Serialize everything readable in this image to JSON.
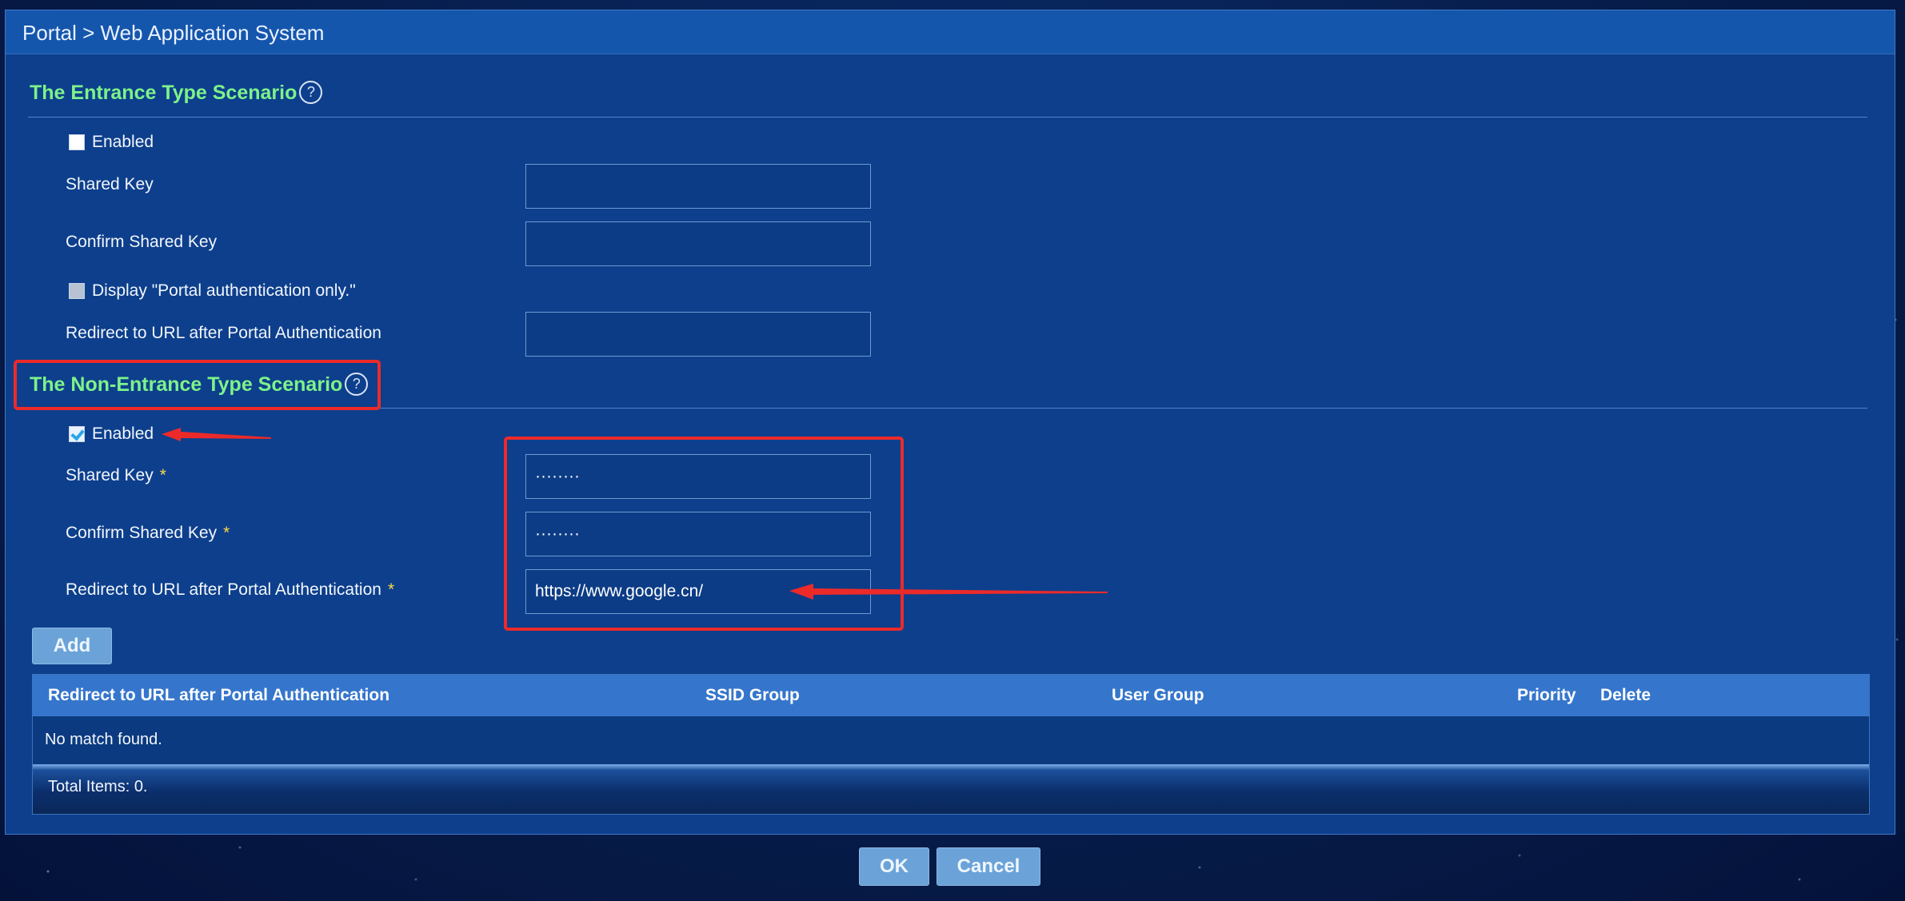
{
  "breadcrumb": "Portal > Web Application System",
  "entrance": {
    "title": "The Entrance Type Scenario",
    "help_icon": "?",
    "enabled_label": "Enabled",
    "shared_key_label": "Shared Key",
    "shared_key_value": "",
    "confirm_key_label": "Confirm Shared Key",
    "confirm_key_value": "",
    "display_only_label": "Display \"Portal authentication only.\"",
    "redirect_label": "Redirect to URL after Portal Authentication",
    "redirect_value": ""
  },
  "non_entrance": {
    "title": "The Non-Entrance Type Scenario",
    "help_icon": "?",
    "enabled_label": "Enabled",
    "enabled_checked": true,
    "shared_key_label": "Shared Key",
    "shared_key_value": "········",
    "confirm_key_label": "Confirm Shared Key",
    "confirm_key_value": "········",
    "redirect_label": "Redirect to URL after Portal Authentication",
    "redirect_value": "https://www.google.cn/",
    "required_mark": "*"
  },
  "add_button": "Add",
  "table": {
    "columns": [
      "Redirect to URL after Portal Authentication",
      "SSID Group",
      "User Group",
      "Priority",
      "Delete"
    ],
    "empty_text": "No match found.",
    "total_text": "Total Items: 0."
  },
  "footer": {
    "ok": "OK",
    "cancel": "Cancel"
  },
  "colors": {
    "section_title": "#7df28a",
    "highlight": "#ec2a2a",
    "panel": "#0d3f8c",
    "header": "#1556ad",
    "button": "#6ba3d8"
  },
  "icons": [
    "help-icon",
    "checkbox-icon",
    "checkmark-icon",
    "arrow-icon"
  ]
}
